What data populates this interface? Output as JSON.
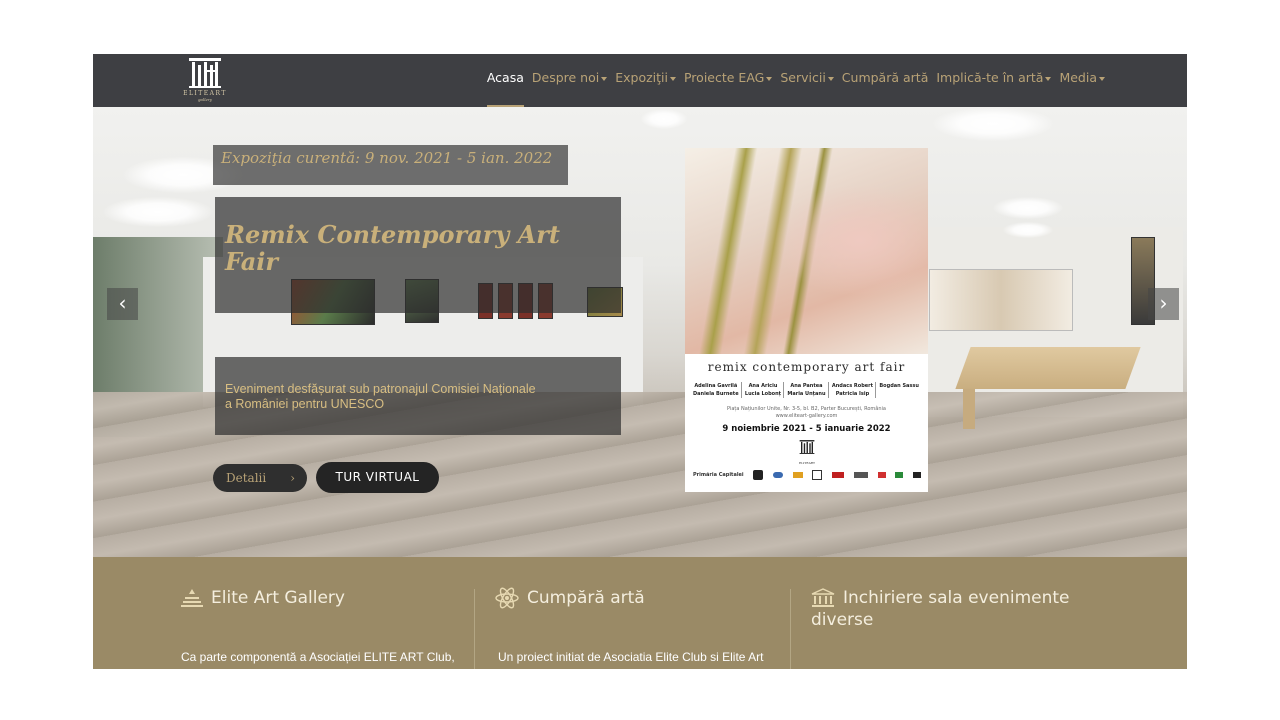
{
  "nav": {
    "logo_text": "ELITEART",
    "logo_sub": "gallery",
    "items": [
      {
        "label": "Acasa",
        "active": true,
        "dropdown": false
      },
      {
        "label": "Despre noi",
        "active": false,
        "dropdown": true
      },
      {
        "label": "Expoziţii",
        "active": false,
        "dropdown": true
      },
      {
        "label": "Proiecte EAG",
        "active": false,
        "dropdown": true
      },
      {
        "label": "Servicii",
        "active": false,
        "dropdown": true
      },
      {
        "label": "Cumpără artă",
        "active": false,
        "dropdown": false
      },
      {
        "label": "Implică-te în artă",
        "active": false,
        "dropdown": true
      },
      {
        "label": "Media",
        "active": false,
        "dropdown": true
      }
    ]
  },
  "hero": {
    "current_exhibition": "Expoziţia curentă: 9 nov. 2021 - 5 ian. 2022",
    "title": "Remix Contemporary Art Fair",
    "subtitle_line1": "Eveniment desfășurat sub patronajul Comisiei Naționale",
    "subtitle_line2": "a României pentru UNESCO",
    "details_button": "Detalii",
    "details_arrow": "›",
    "virtual_tour_button": "TUR VIRTUAL",
    "prev_arrow": "‹",
    "next_arrow": "›"
  },
  "poster": {
    "title": "remix contemporary art fair",
    "artists": [
      [
        "Adelina Gavrilă",
        "Daniela Burnete"
      ],
      [
        "Ana Ariciu",
        "Lucia Lobonț"
      ],
      [
        "Ana Pantea",
        "Maria Unțanu"
      ],
      [
        "Andacs Robert",
        "Patricia Isip"
      ],
      [
        "Bogdan Sassu"
      ]
    ],
    "address": "Piața Națiunilor Unite, Nr. 3-5, bl. B2, Parter București, România",
    "website": "www.eliteart-gallery.com",
    "dates": "9 noiembrie 2021 - 5 ianuarie 2022",
    "logo_text": "ELITEART",
    "sponsors": [
      "Primăria Capitalei"
    ]
  },
  "info": {
    "columns": [
      {
        "title": "Elite Art Gallery",
        "text": "Ca parte componentă a Asociației ELITE ART Club,"
      },
      {
        "title": "Cumpără artă",
        "text": "Un proiect initiat de Asociatia Elite Club si Elite Art"
      },
      {
        "title_line1": "Inchiriere sala evenimente",
        "title_line2": "diverse"
      }
    ]
  },
  "colors": {
    "nav_bg": "#3e3f43",
    "gold": "#b8a276",
    "info_bg": "#9a8a66"
  }
}
